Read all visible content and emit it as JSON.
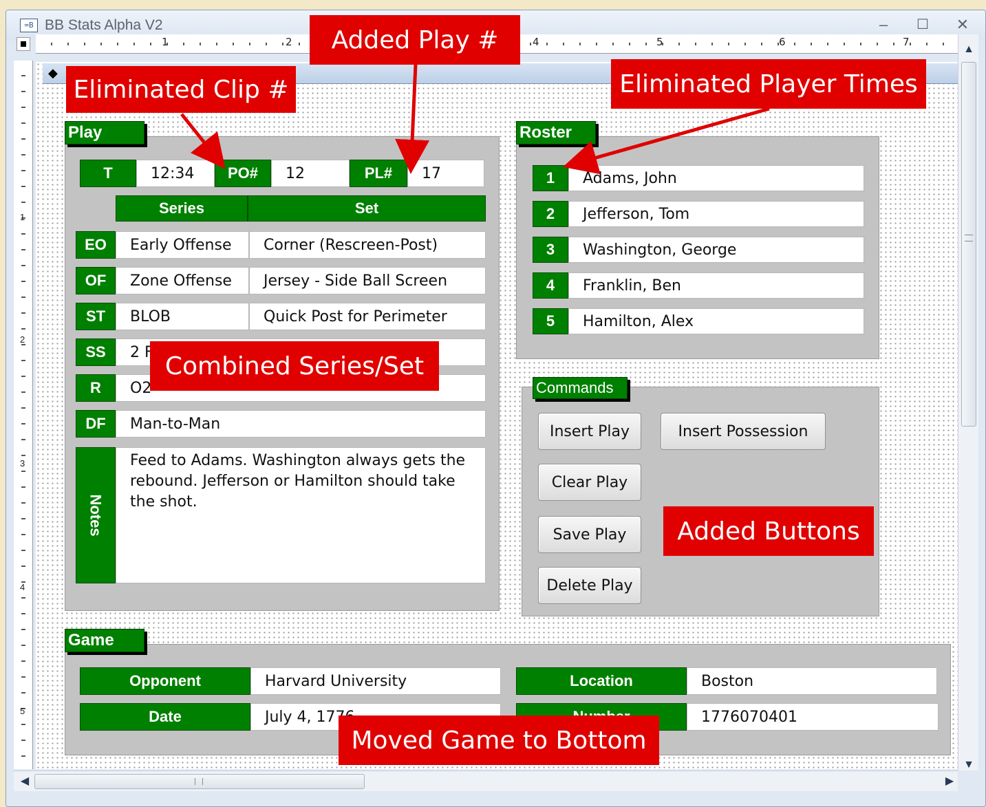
{
  "window": {
    "title": "BB Stats Alpha V2",
    "icon": "form-icon",
    "minimize": "–",
    "maximize": "☐",
    "close": "✕"
  },
  "ruler": {
    "top_labels": [
      "1",
      "2",
      "4",
      "5",
      "6",
      "7"
    ],
    "left_labels": [
      "1",
      "2",
      "3",
      "4",
      "5"
    ]
  },
  "play": {
    "tab": "Play",
    "t_label": "T",
    "t_value": "12:34",
    "po_label": "PO#",
    "po_value": "12",
    "pl_label": "PL#",
    "pl_value": "17",
    "col_series": "Series",
    "col_set": "Set",
    "rows": [
      {
        "code": "EO",
        "series": "Early Offense",
        "set": "Corner (Rescreen-Post)"
      },
      {
        "code": "OF",
        "series": "Zone Offense",
        "set": "Jersey - Side Ball Screen"
      },
      {
        "code": "ST",
        "series": "BLOB",
        "set": "Quick Post for Perimeter"
      }
    ],
    "ss_label": "SS",
    "ss_value": "2 F",
    "r_label": "R",
    "r_value": "O2",
    "df_label": "DF",
    "df_value": "Man-to-Man",
    "notes_label": "Notes",
    "notes_value": "Feed to Adams.  Washington always gets the rebound.  Jefferson or Hamilton should take the shot."
  },
  "roster": {
    "tab": "Roster",
    "players": [
      {
        "num": "1",
        "name": "Adams, John"
      },
      {
        "num": "2",
        "name": "Jefferson, Tom"
      },
      {
        "num": "3",
        "name": "Washington, George"
      },
      {
        "num": "4",
        "name": "Franklin, Ben"
      },
      {
        "num": "5",
        "name": "Hamilton, Alex"
      }
    ]
  },
  "commands": {
    "tab": "Commands",
    "insert_play": "Insert Play",
    "insert_possession": "Insert Possession",
    "clear_play": "Clear Play",
    "save_play": "Save Play",
    "delete_play": "Delete Play"
  },
  "game": {
    "tab": "Game",
    "opponent_label": "Opponent",
    "opponent_value": "Harvard University",
    "location_label": "Location",
    "location_value": "Boston",
    "date_label": "Date",
    "date_value": "July 4, 1776",
    "number_label": "Number",
    "number_value": "1776070401"
  },
  "callouts": {
    "eliminated_clip": "Eliminated Clip #",
    "added_play": "Added Play #",
    "eliminated_player_times": "Eliminated Player Times",
    "combined_series": "Combined Series/Set",
    "added_buttons": "Added Buttons",
    "moved_game": "Moved Game to Bottom"
  },
  "colors": {
    "accent": "#008000",
    "callout": "#e00000",
    "panel": "#c3c3c3"
  }
}
